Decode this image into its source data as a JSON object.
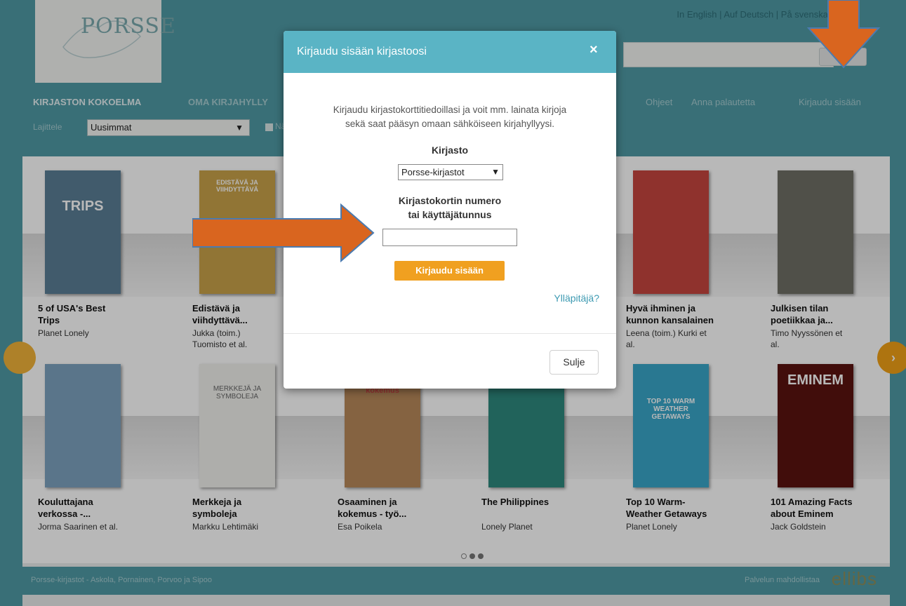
{
  "header": {
    "logo_text": "PORSSE",
    "languages": "In English | Auf Deutsch | På svenska"
  },
  "nav": {
    "items": [
      "KIRJASTON KOKOELMA",
      "OMA KIRJAHYLLY",
      "Ohjeet",
      "Anna palautetta",
      "Kirjaudu sisään"
    ],
    "sort_label": "Lajittele",
    "sort_value": "Uusimmat",
    "checkbox_label": "Näytä"
  },
  "books_row1": [
    {
      "title_1": "5 of USA's Best",
      "title_2": "Trips",
      "author_1": "Planet Lonely",
      "author_2": ""
    },
    {
      "title_1": "Edistävä ja",
      "title_2": "viihdyttävä...",
      "author_1": "Jukka (toim.)",
      "author_2": "Tuomisto et al."
    },
    {
      "title_1": "Hyvä ihminen ja",
      "title_2": "kunnon kansalainen",
      "author_1": "Leena (toim.) Kurki et",
      "author_2": "al."
    },
    {
      "title_1": "Julkisen tilan",
      "title_2": "poetiikkaa ja...",
      "author_1": "Timo Nyyssönen et",
      "author_2": "al."
    }
  ],
  "books_row2": [
    {
      "title_1": "Kouluttajana",
      "title_2": "verkossa -...",
      "author_1": "Jorma Saarinen et al.",
      "author_2": ""
    },
    {
      "title_1": "Merkkeja ja",
      "title_2": "symboleja",
      "author_1": "Markku Lehtimäki",
      "author_2": ""
    },
    {
      "title_1": "Osaaminen ja",
      "title_2": "kokemus - työ...",
      "author_1": "Esa Poikela",
      "author_2": ""
    },
    {
      "title_1": "The Philippines",
      "title_2": "",
      "author_1": "Lonely Planet",
      "author_2": ""
    },
    {
      "title_1": "Top 10 Warm-",
      "title_2": "Weather Getaways",
      "author_1": "Planet Lonely",
      "author_2": ""
    },
    {
      "title_1": "101 Amazing Facts",
      "title_2": "about Eminem",
      "author_1": "Jack Goldstein",
      "author_2": ""
    }
  ],
  "covers": {
    "c1": "TRIPS",
    "c2": "EDISTÄVÄ JA VIIHDYTTÄVÄ",
    "c6": "MERKKEJÄ JA SYMBOLEJA",
    "c7": "kokemus",
    "c9": "TOP 10 WARM WEATHER GETAWAYS",
    "c10": "EMINEM"
  },
  "footer": {
    "left": "Porsse-kirjastot - Askola, Pornainen, Porvoo ja Sipoo",
    "right": "Palvelun mahdollistaa",
    "brand": "ellibs"
  },
  "modal": {
    "title": "Kirjaudu sisään kirjastoosi",
    "close_icon": "×",
    "intro_1": "Kirjaudu kirjastokorttitiedoillasi ja voit mm. lainata kirjoja",
    "intro_2": "sekä saat pääsyn omaan sähköiseen kirjahyllyysi.",
    "library_label": "Kirjasto",
    "library_value": "Porsse-kirjastot",
    "card_label_1": "Kirjastokortin numero",
    "card_label_2": "tai käyttäjätunnus",
    "card_value": "",
    "login_button": "Kirjaudu sisään",
    "admin_link": "Ylläpitäjä?",
    "close_button": "Sulje"
  },
  "colors": {
    "header": "#4f9aa6",
    "modal_head": "#5ab4c5",
    "accent": "#f0a020",
    "arrow": "#d9651f"
  }
}
